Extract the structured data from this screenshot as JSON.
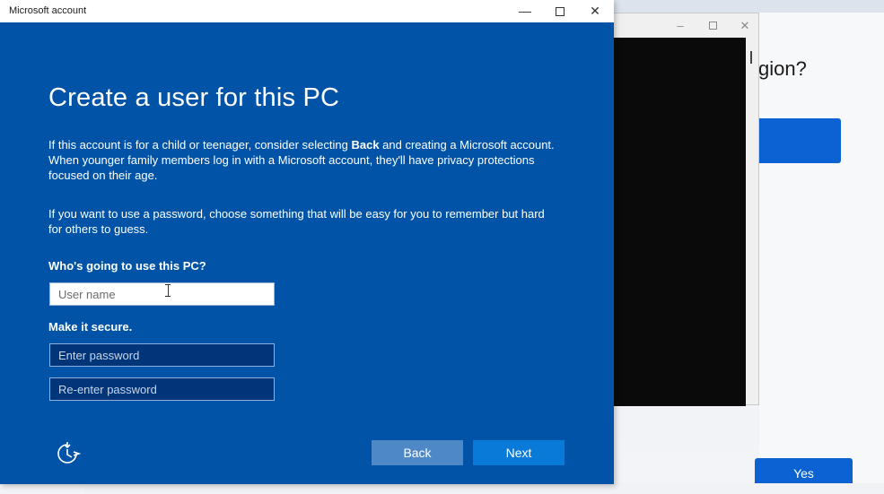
{
  "main_window": {
    "title": "Microsoft account",
    "heading": "Create a user for this PC",
    "paragraph1": {
      "before": "If this account is for a child or teenager, consider selecting ",
      "bold": "Back",
      "after": " and creating a Microsoft account. When younger family members log in with a Microsoft account, they'll have privacy protections focused on their age."
    },
    "paragraph2": "If you want to use a password, choose something that will be easy for you to remember but hard for others to guess.",
    "user_label": "Who's going to use this PC?",
    "username_placeholder": "User name",
    "secure_label": "Make it secure.",
    "password_placeholder": "Enter password",
    "reenter_placeholder": "Re-enter password",
    "back_label": "Back",
    "next_label": "Next",
    "icons": {
      "minimize": "minimize-icon",
      "maximize": "maximize-icon",
      "close": "close-icon",
      "accessibility": "accessibility-icon"
    }
  },
  "background": {
    "heading_fragment": "gion?",
    "yes_label": "Yes"
  },
  "colors": {
    "window_blue": "#0053a6",
    "next_button": "#0a7ad9",
    "back_button": "#4f88c6",
    "oobe_blue": "#0c62d2"
  }
}
